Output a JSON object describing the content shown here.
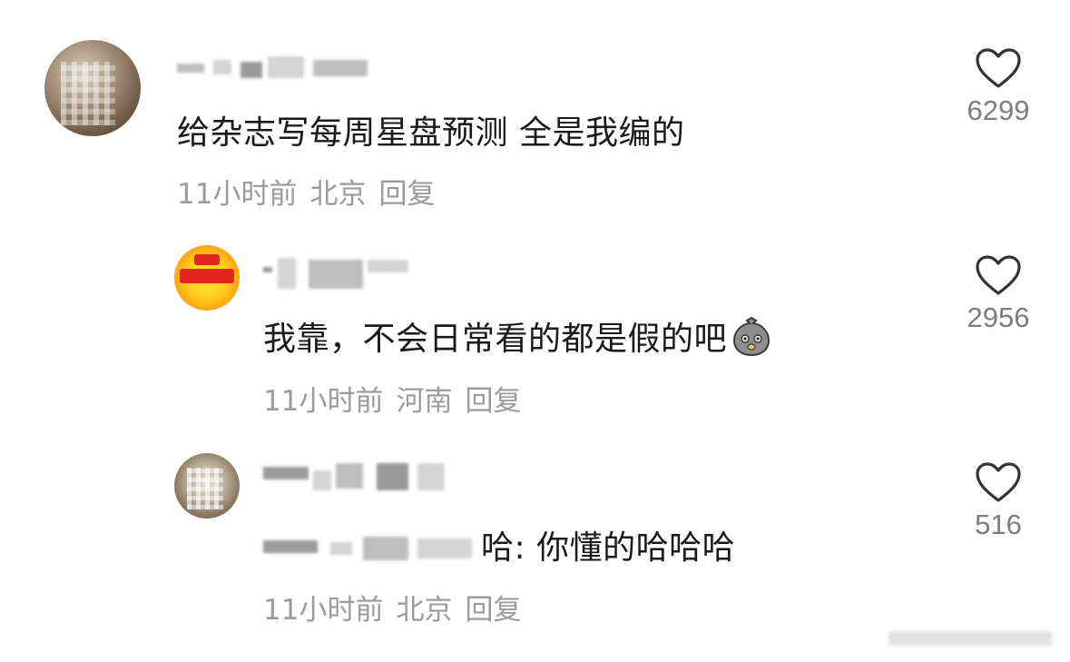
{
  "comments": [
    {
      "text": "给杂志写每周星盘预测 全是我编的",
      "time": "11小时前",
      "location": "北京",
      "reply_label": "回复",
      "likes": "6299",
      "avatar_icon": "cat-photo-avatar"
    },
    {
      "text": "我靠，不会日常看的都是假的吧",
      "time": "11小时前",
      "location": "河南",
      "reply_label": "回复",
      "likes": "2956",
      "emoji_icon": "pigeon-sticker-icon",
      "avatar_icon": "badge-avatar"
    },
    {
      "text": "哈: 你懂的哈哈哈",
      "time": "11小时前",
      "location": "北京",
      "reply_label": "回复",
      "likes": "516",
      "avatar_icon": "glass-photo-avatar"
    }
  ],
  "colors": {
    "text": "#1a1a1a",
    "meta": "#9b9b9b",
    "like_count": "#7d7d7d",
    "heart_stroke": "#333333"
  }
}
